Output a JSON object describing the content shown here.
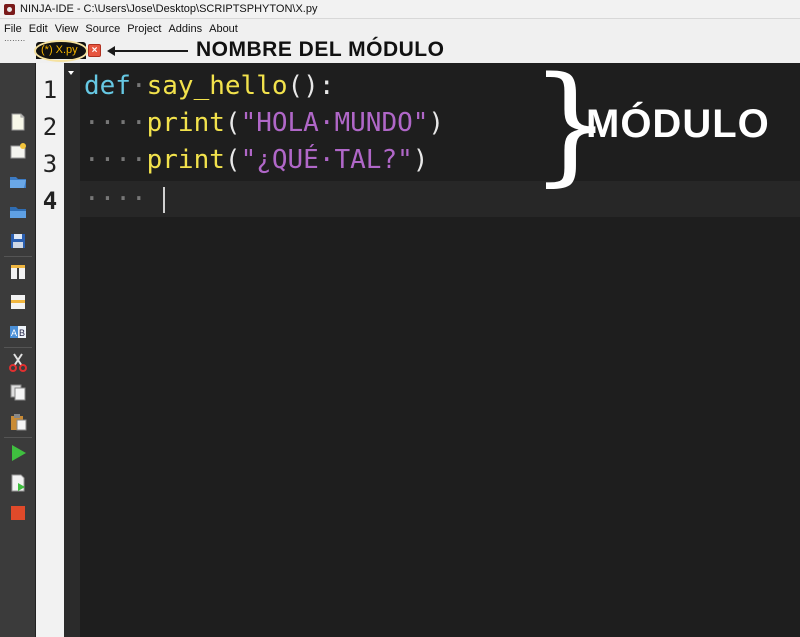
{
  "window": {
    "title": "NINJA-IDE - C:\\Users\\Jose\\Desktop\\SCRIPTSPHYTON\\X.py"
  },
  "menu": [
    "File",
    "Edit",
    "View",
    "Source",
    "Project",
    "Addins",
    "About"
  ],
  "tab": {
    "label": "(*) X.py",
    "close_glyph": "×"
  },
  "annotations": {
    "module_name": "NOMBRE DEL MÓDULO",
    "module": "MÓDULO"
  },
  "toolbar_icons": [
    "new-file-icon",
    "new-project-icon",
    "open-file-icon",
    "open-project-icon",
    "save-icon",
    "split-vertical-icon",
    "split-horizontal-icon",
    "find-replace-icon",
    "cut-icon",
    "copy-icon",
    "paste-icon",
    "run-icon",
    "run-file-icon",
    "stop-icon"
  ],
  "editor": {
    "line_numbers": [
      "1",
      "2",
      "3",
      "4"
    ],
    "lines": [
      {
        "kw": "def",
        "ws": "·",
        "fn": "say_hello",
        "pn": "():"
      },
      {
        "ws": "····",
        "fn": "print",
        "open": "(",
        "str": "\"HOLA·MUNDO\"",
        "close": ")"
      },
      {
        "ws": "····",
        "fn": "print",
        "open": "(",
        "str": "\"¿QUÉ·TAL?\"",
        "close": ")"
      },
      {
        "ws": "····"
      }
    ],
    "brace_glyph": "}"
  },
  "colors": {
    "keyword": "#66c8e3",
    "function": "#f2e24c",
    "string": "#b067c8",
    "tab_text": "#f5b400",
    "annotation": "#ffffff"
  }
}
